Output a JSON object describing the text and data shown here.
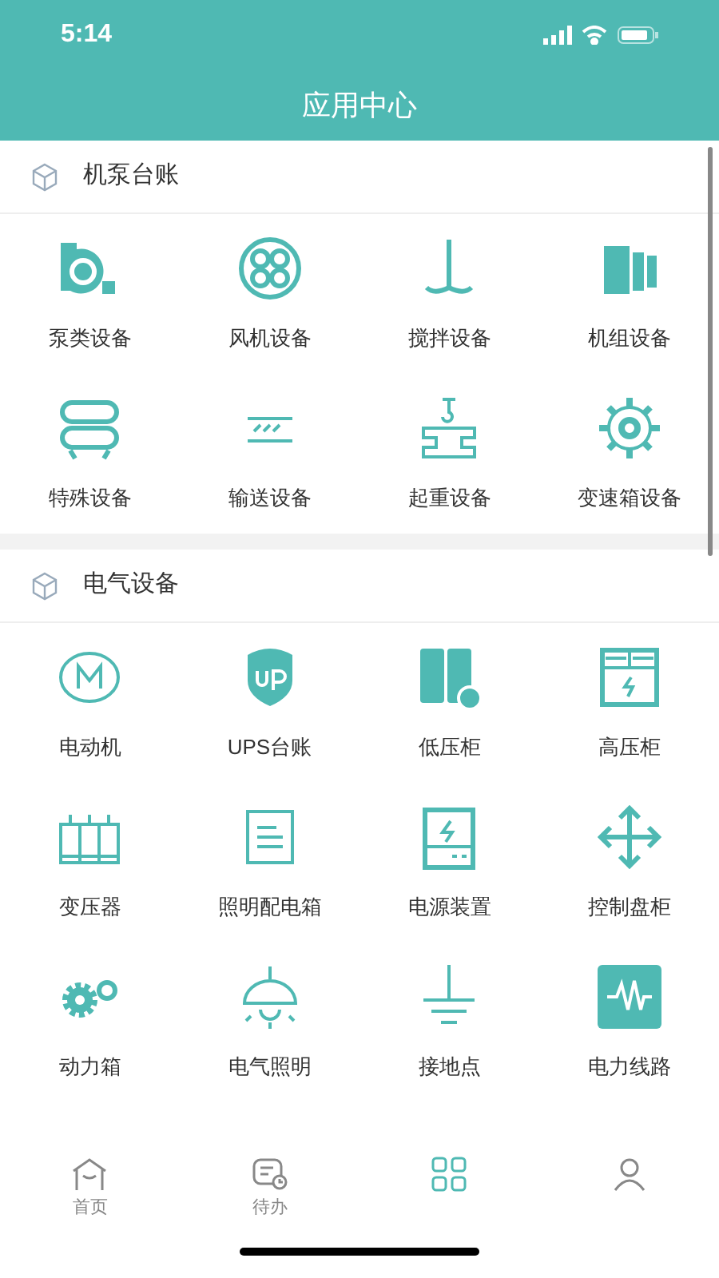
{
  "status_bar": {
    "time": "5:14"
  },
  "header": {
    "title": "应用中心"
  },
  "sections": [
    {
      "title": "机泵台账",
      "items": [
        {
          "label": "泵类设备"
        },
        {
          "label": "风机设备"
        },
        {
          "label": "搅拌设备"
        },
        {
          "label": "机组设备"
        },
        {
          "label": "特殊设备"
        },
        {
          "label": "输送设备"
        },
        {
          "label": "起重设备"
        },
        {
          "label": "变速箱设备"
        }
      ]
    },
    {
      "title": "电气设备",
      "items": [
        {
          "label": "电动机"
        },
        {
          "label": "UPS台账"
        },
        {
          "label": "低压柜"
        },
        {
          "label": "高压柜"
        },
        {
          "label": "变压器"
        },
        {
          "label": "照明配电箱"
        },
        {
          "label": "电源装置"
        },
        {
          "label": "控制盘柜"
        },
        {
          "label": "动力箱"
        },
        {
          "label": "电气照明"
        },
        {
          "label": "接地点"
        },
        {
          "label": "电力线路"
        }
      ]
    }
  ],
  "tab_bar": [
    {
      "label": "首页",
      "selected": false
    },
    {
      "label": "待办",
      "selected": false
    },
    {
      "selected": true
    },
    {
      "selected": false
    }
  ]
}
